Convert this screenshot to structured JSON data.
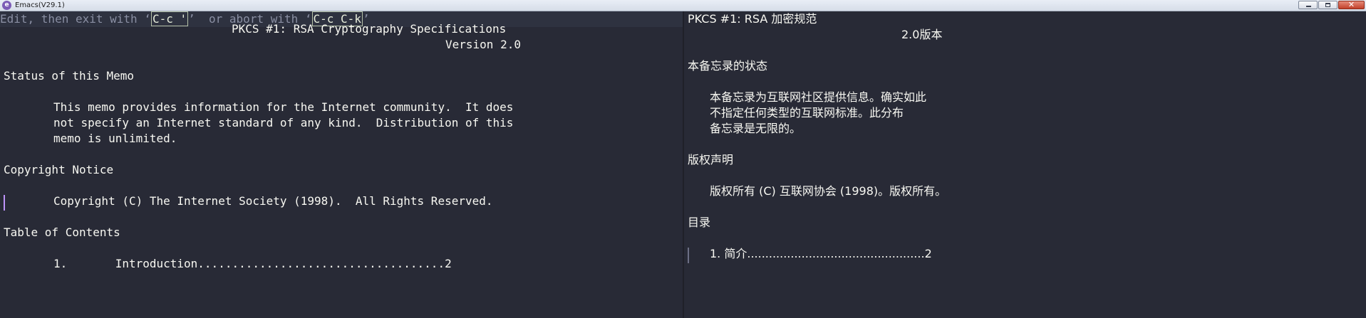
{
  "window": {
    "title": "Emacs(V29.1)",
    "icon": "emacs-icon",
    "buttons": [
      "minimize-icon",
      "maximize-icon",
      "close-icon"
    ],
    "close_glyph": "✕"
  },
  "left": {
    "header": {
      "prefix": "Edit, then exit with ",
      "quote_open_1": "‘",
      "key1": "C-c '",
      "quote_close_1": "’",
      "middle": "  or abort with ",
      "quote_open_2": "‘",
      "key2": "C-c C-k",
      "quote_close_2": "’"
    },
    "lines": {
      "l1": "PKCS #1: RSA Cryptography Specifications",
      "l2": "Version 2.0",
      "l3": "Status of this Memo",
      "l4": "This memo provides information for the Internet community.  It does",
      "l5": "not specify an Internet standard of any kind.  Distribution of this",
      "l6": "memo is unlimited.",
      "l7": "Copyright Notice",
      "l8": "Copyright (C) The Internet Society (1998).  All Rights Reserved.",
      "l9": "Table of Contents",
      "l10": "1.       Introduction....................................2"
    }
  },
  "right": {
    "lines": {
      "r1": "PKCS #1: RSA 加密规范",
      "r2": "2.0版本",
      "r3": "本备忘录的状态",
      "r4": "本备忘录为互联网社区提供信息。确实如此",
      "r5": "不指定任何类型的互联网标准。此分布",
      "r6": "备忘录是无限的。",
      "r7": "版权声明",
      "r8": "版权所有 (C) 互联网协会 (1998)。版权所有。",
      "r9": "目录",
      "r10": "1. 简介.................................................2"
    }
  },
  "colors": {
    "background": "#282a36",
    "foreground": "#f8f8f2",
    "muted": "#8a8fa3",
    "cursor": "#bd93f9"
  }
}
